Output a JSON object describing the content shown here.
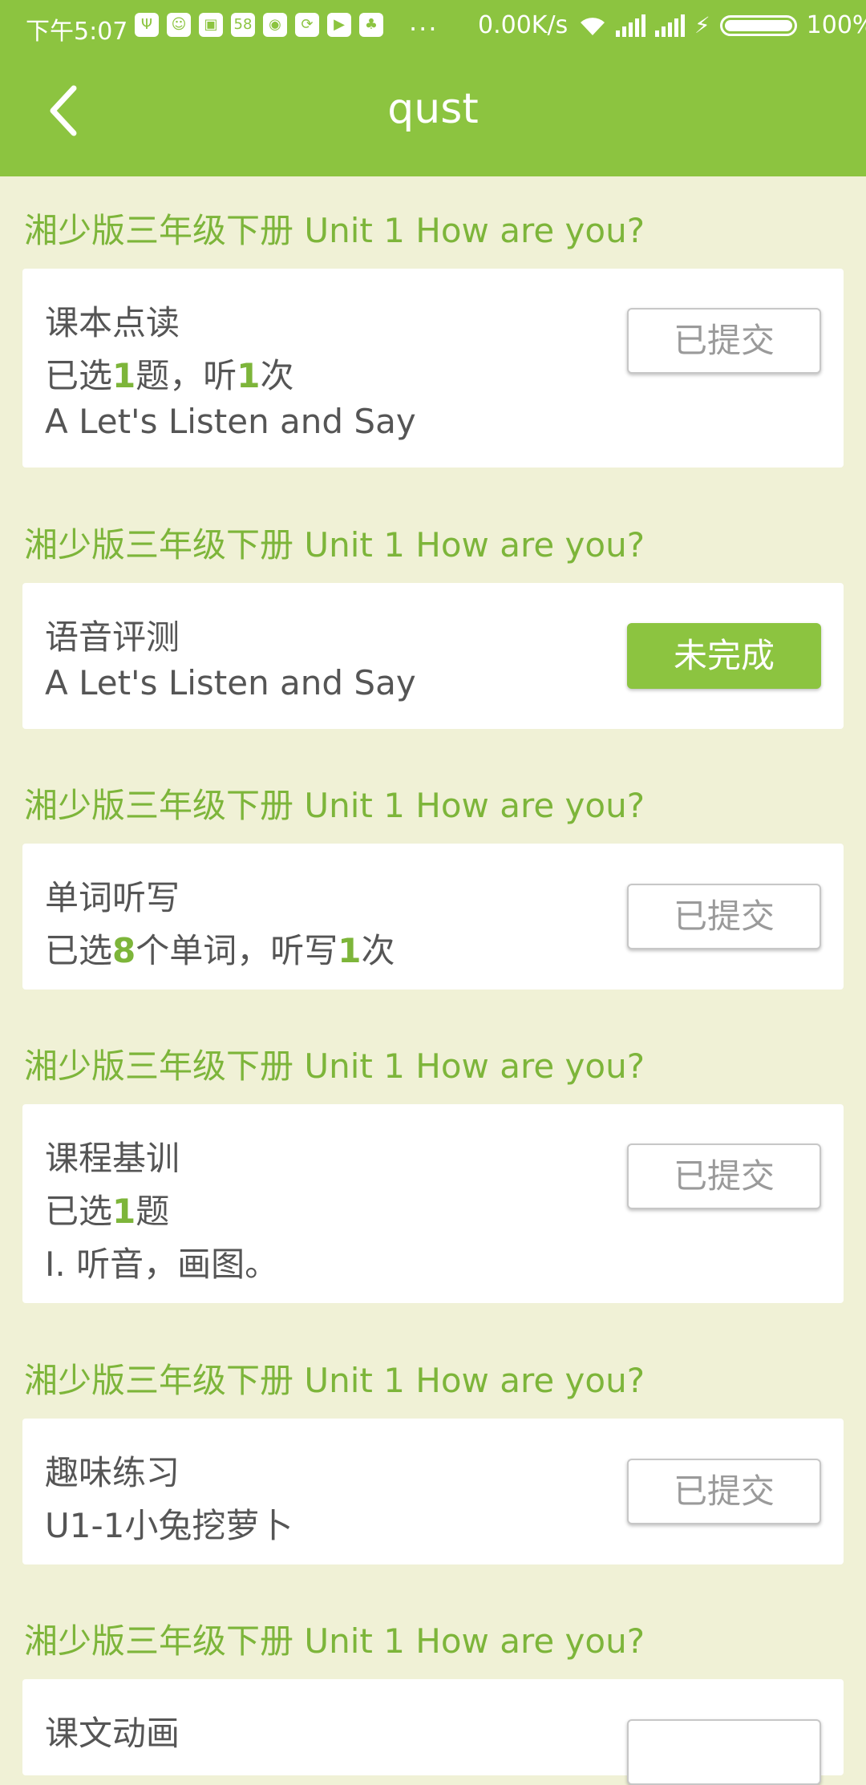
{
  "status_bar": {
    "time": "下午5:07",
    "net_speed": "0.00K/s",
    "battery": "100%",
    "notif_icons": [
      "Ψ",
      "☺",
      "▣",
      "58",
      "◉",
      "⟳",
      "▶",
      "♣"
    ],
    "more": "..."
  },
  "header": {
    "title": "qust",
    "back_icon": "chevron-left-icon"
  },
  "sections": [
    {
      "heading": "湘少版三年级下册 Unit 1 How are you?",
      "card": {
        "line1": "课本点读",
        "line2_parts": [
          "已选",
          "1",
          "题，听",
          "1",
          "次"
        ],
        "line3": "A Let's Listen and Say",
        "button": "已提交"
      }
    },
    {
      "heading": "湘少版三年级下册 Unit 1 How are you?",
      "card": {
        "line1": "语音评测",
        "line2": "A Let's Listen and Say",
        "button": "未完成"
      }
    },
    {
      "heading": "湘少版三年级下册 Unit 1 How are you?",
      "card": {
        "line1": "单词听写",
        "line2_parts": [
          "已选",
          "8",
          "个单词，听写",
          "1",
          "次"
        ],
        "button": "已提交"
      }
    },
    {
      "heading": "湘少版三年级下册 Unit 1 How are you?",
      "card": {
        "line1": "课程基训",
        "line2_parts": [
          "已选",
          "1",
          "题"
        ],
        "line3": "I. 听音，画图。",
        "button": "已提交"
      }
    },
    {
      "heading": "湘少版三年级下册 Unit 1 How are you?",
      "card": {
        "line1": "趣味练习",
        "line2": "U1-1小兔挖萝卜",
        "button": "已提交"
      }
    },
    {
      "heading": "湘少版三年级下册 Unit 1 How are you?",
      "card": {
        "line1": "课文动画"
      }
    }
  ]
}
